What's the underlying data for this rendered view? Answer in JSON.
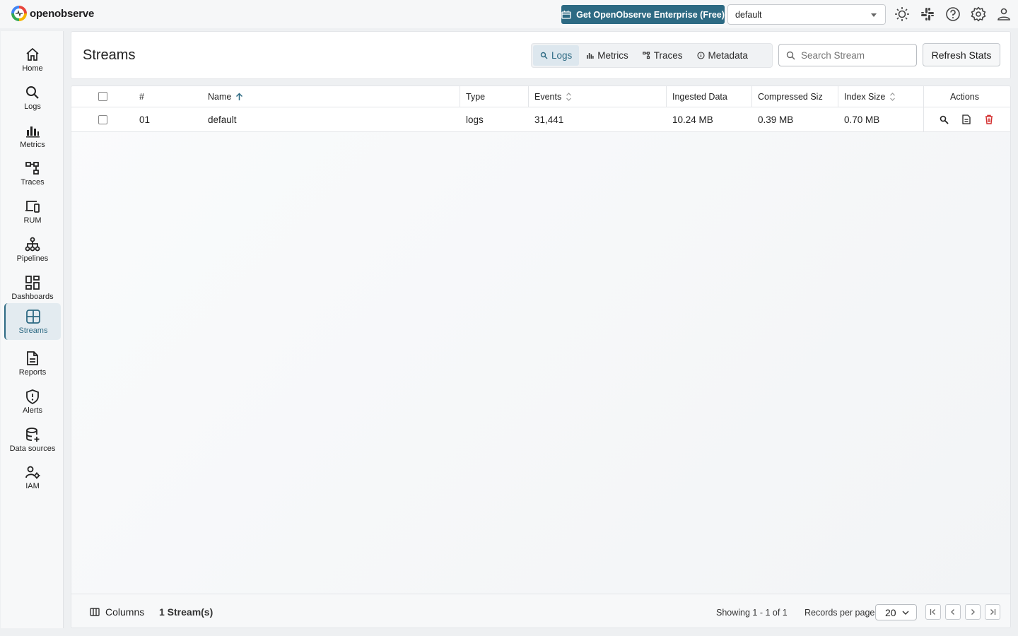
{
  "app": {
    "name": "openobserve"
  },
  "header": {
    "enterprise_label": "Get OpenObserve Enterprise (Free)",
    "org_value": "default",
    "icons": [
      "theme-icon",
      "slack-icon",
      "help-icon",
      "settings-icon",
      "user-icon"
    ]
  },
  "sidebar": {
    "items": [
      {
        "label": "Home",
        "icon": "home-icon"
      },
      {
        "label": "Logs",
        "icon": "search-icon"
      },
      {
        "label": "Metrics",
        "icon": "bar-chart-icon"
      },
      {
        "label": "Traces",
        "icon": "traces-icon"
      },
      {
        "label": "RUM",
        "icon": "devices-icon"
      },
      {
        "label": "Pipelines",
        "icon": "pipeline-icon"
      },
      {
        "label": "Dashboards",
        "icon": "dashboard-icon"
      },
      {
        "label": "Streams",
        "icon": "streams-icon",
        "active": true
      },
      {
        "label": "Reports",
        "icon": "report-icon"
      },
      {
        "label": "Alerts",
        "icon": "alert-icon"
      },
      {
        "label": "Data sources",
        "icon": "database-add-icon"
      },
      {
        "label": "IAM",
        "icon": "iam-icon"
      }
    ]
  },
  "main": {
    "title": "Streams",
    "tabs": [
      {
        "label": "Logs",
        "icon": "search-icon",
        "active": true
      },
      {
        "label": "Metrics",
        "icon": "bar-chart-icon"
      },
      {
        "label": "Traces",
        "icon": "traces-icon"
      },
      {
        "label": "Metadata",
        "icon": "info-icon"
      }
    ],
    "search_placeholder": "Search Stream",
    "refresh_label": "Refresh Stats"
  },
  "table": {
    "headers": {
      "index": "#",
      "name": "Name",
      "type": "Type",
      "events": "Events",
      "ingested": "Ingested Data",
      "compressed": "Compressed Siz",
      "index_size": "Index Size",
      "actions": "Actions"
    },
    "rows": [
      {
        "index": "01",
        "name": "default",
        "type": "logs",
        "events": "31,441",
        "ingested": "10.24 MB",
        "compressed": "0.39 MB",
        "index_size": "0.70 MB"
      }
    ]
  },
  "footer": {
    "columns_label": "Columns",
    "stream_count": "1 Stream(s)",
    "showing": "Showing 1 - 1 of 1",
    "records_per_page_label": "Records per page",
    "records_per_page_value": "20"
  },
  "colors": {
    "accent": "#2d6a83",
    "delete": "#d32f2f"
  }
}
